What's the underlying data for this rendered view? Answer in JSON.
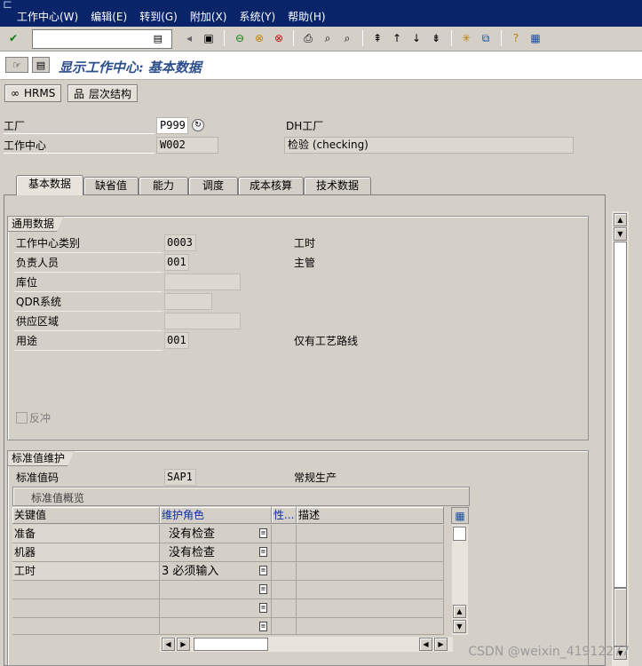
{
  "menu": [
    "工作中心(W)",
    "编辑(E)",
    "转到(G)",
    "附加(X)",
    "系统(Y)",
    "帮助(H)"
  ],
  "title": "显示工作中心: 基本数据",
  "app_toolbar": {
    "hrms": "HRMS",
    "hierarchy": "层次结构"
  },
  "header": {
    "plant_label": "工厂",
    "plant_value": "P999",
    "plant_desc": "DH工厂",
    "wc_label": "工作中心",
    "wc_value": "W002",
    "wc_desc": "检验 (checking)"
  },
  "tabs": [
    "基本数据",
    "缺省值",
    "能力",
    "调度",
    "成本核算",
    "技术数据"
  ],
  "general": {
    "title": "通用数据",
    "rows": [
      {
        "label": "工作中心类别",
        "value": "0003",
        "desc": "工时"
      },
      {
        "label": "负责人员",
        "value": "001",
        "desc": "主管"
      },
      {
        "label": "库位",
        "value": "",
        "desc": ""
      },
      {
        "label": "QDR系统",
        "value": "",
        "desc": ""
      },
      {
        "label": "供应区域",
        "value": "",
        "desc": ""
      },
      {
        "label": "用途",
        "value": "001",
        "desc": "仅有工艺路线"
      }
    ],
    "checkbox_label": "反冲"
  },
  "std": {
    "title": "标准值维护",
    "key_label": "标准值码",
    "key_value": "SAP1",
    "key_desc": "常规生产",
    "overview_title": "标准值概览",
    "columns": [
      "关键值",
      "维护角色",
      "性...",
      "描述"
    ],
    "rows": [
      {
        "key": "准备",
        "role": "没有检查"
      },
      {
        "key": "机器",
        "role": "没有检查"
      },
      {
        "key": "工时",
        "role": "3 必须输入"
      },
      {
        "key": "",
        "role": ""
      },
      {
        "key": "",
        "role": ""
      },
      {
        "key": "",
        "role": ""
      }
    ]
  },
  "watermark": "CSDN @weixin_41912277",
  "colors": {
    "menubar": "#0a246a",
    "title": "#2c4f8c",
    "background": "#d4d0c8"
  }
}
